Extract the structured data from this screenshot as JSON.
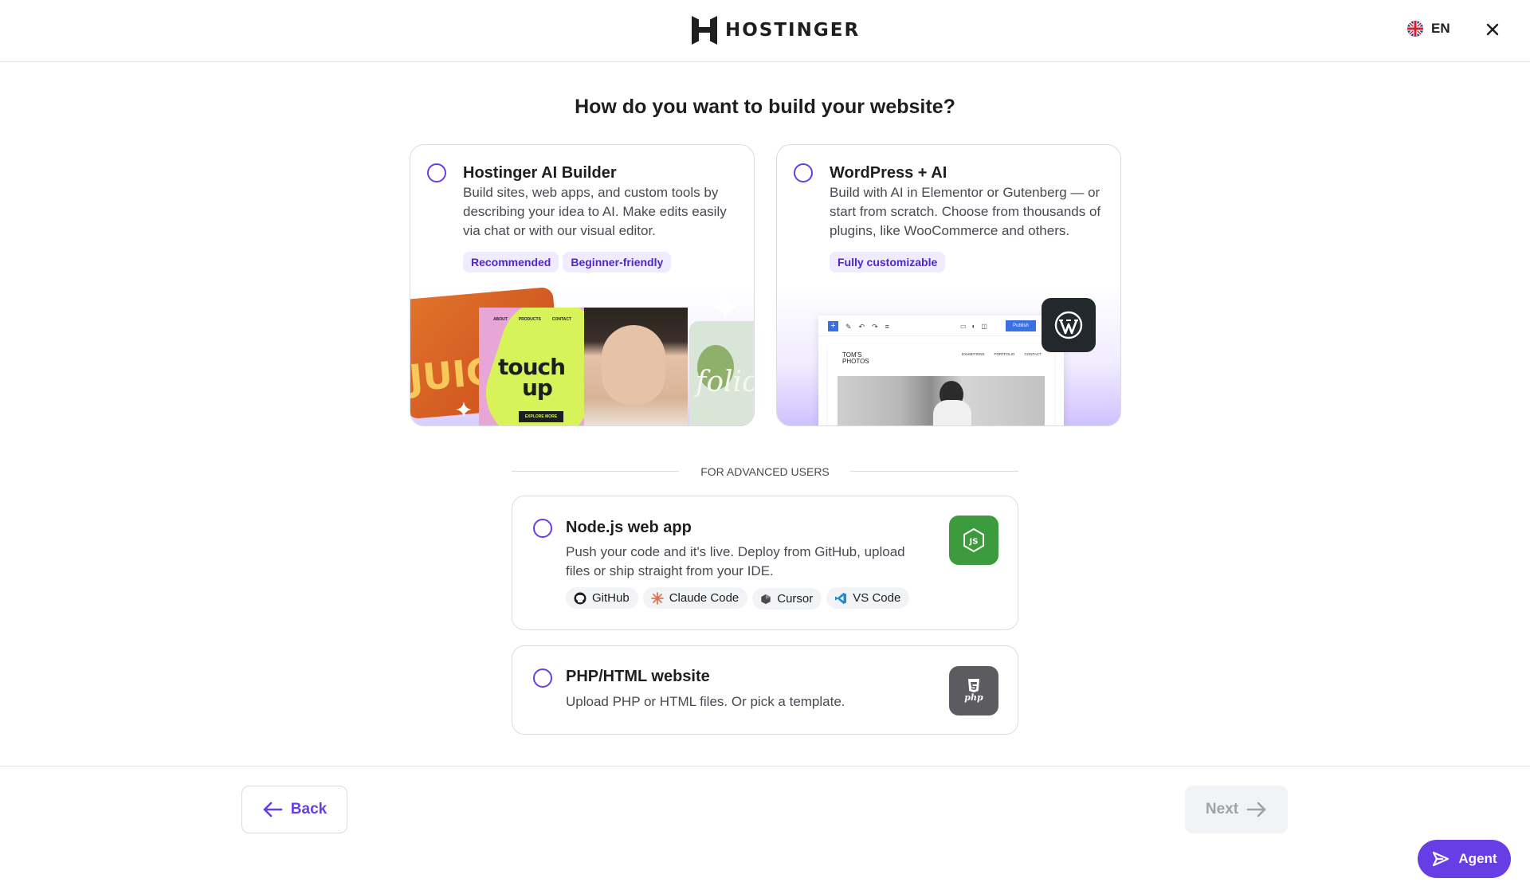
{
  "header": {
    "brand": "HOSTINGER",
    "language": "EN",
    "close_icon": "close-icon",
    "flag_icon": "uk-flag-icon"
  },
  "title": "How do you want to build your website?",
  "options": [
    {
      "title": "Hostinger AI Builder",
      "description": "Build sites, web apps, and custom tools by describing your idea to AI. Make edits easily via chat or with our visual editor.",
      "tags": [
        "Recommended",
        "Beginner-friendly"
      ],
      "preview": {
        "nav": [
          "ABOUT",
          "PRODUCTS",
          "CONTACT"
        ],
        "headline_1": "touch",
        "headline_2": "up",
        "cta": "EXPLORE MORE",
        "back_left": "JUIC",
        "back_right": "folio"
      }
    },
    {
      "title": "WordPress + AI",
      "description": "Build with AI in Elementor or Gutenberg — or start from scratch. Choose from thousands of plugins, like WooCommerce and others.",
      "tags": [
        "Fully customizable"
      ],
      "preview": {
        "publish": "Publish",
        "site_title": "TOM'S PHOTOS",
        "nav": [
          "EXHIBITIONS",
          "PORTFOLIO",
          "CONTACT"
        ],
        "logo_icon": "wordpress-icon"
      }
    }
  ],
  "advanced": {
    "label": "FOR ADVANCED USERS",
    "options": [
      {
        "title": "Node.js web app",
        "description": "Push your code and it's live. Deploy from GitHub, upload files or ship straight from your IDE.",
        "tools": [
          {
            "label": "GitHub",
            "icon": "github-icon"
          },
          {
            "label": "Claude Code",
            "icon": "claude-icon"
          },
          {
            "label": "Cursor",
            "icon": "cursor-icon"
          },
          {
            "label": "VS Code",
            "icon": "vscode-icon"
          }
        ],
        "icon": "nodejs-icon"
      },
      {
        "title": "PHP/HTML website",
        "description": "Upload PHP or HTML files. Or pick a template.",
        "icon": "php-html-icon",
        "icon_text": "php"
      }
    ]
  },
  "footer": {
    "back": "Back",
    "next": "Next",
    "agent": "Agent"
  },
  "colors": {
    "accent": "#673de6",
    "tag_bg": "#f0ebff",
    "node_green": "#3c9b3c",
    "php_gray": "#5b5b60"
  }
}
